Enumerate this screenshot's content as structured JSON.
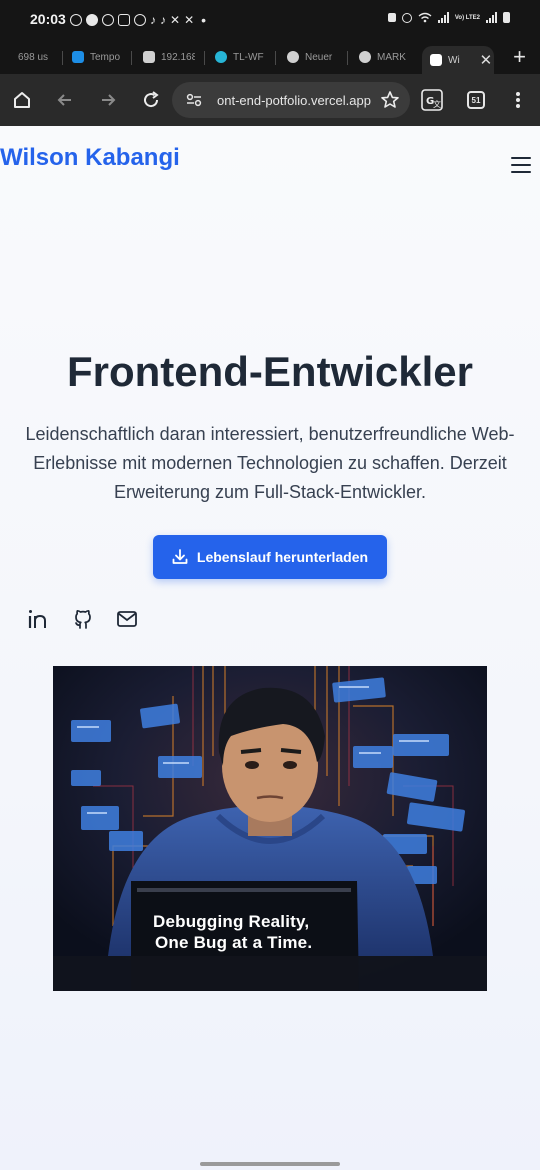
{
  "status_bar": {
    "time": "20:03",
    "network_label": "Vo) LTE2",
    "icons": [
      "whatsapp-icon",
      "chat-icon",
      "whatsapp-icon",
      "instagram-icon",
      "whatsapp-icon",
      "tiktok-icon",
      "tiktok-icon",
      "x-icon",
      "x-icon"
    ]
  },
  "browser": {
    "tabs": [
      {
        "label": "698 us",
        "favicon_color": "#666666"
      },
      {
        "label": "Tempo",
        "favicon_color": "#1d8ee6"
      },
      {
        "label": "192.168",
        "favicon_color": "#d0d0d0"
      },
      {
        "label": "TL-WF",
        "favicon_color": "#27b5d6"
      },
      {
        "label": "Neuer",
        "favicon_color": "#d0d0d0"
      },
      {
        "label": "MARK",
        "favicon_color": "#d0d0d0"
      },
      {
        "label": "Wi",
        "favicon_color": "#ffffff"
      }
    ],
    "url": "ont-end-potfolio.vercel.app",
    "tab_count": "51"
  },
  "page": {
    "brand": "Wilson Kabangi",
    "hero_title": "Frontend-Entwickler",
    "hero_text": "Leidenschaftlich daran interessiert, benutzerfreundliche Web-Erlebnisse mit modernen Technologien zu schaffen. Derzeit Erweiterung zum Full-Stack-Entwickler.",
    "cv_button": "Lebenslauf herunterladen",
    "socials": [
      "linkedin-icon",
      "github-icon",
      "mail-icon"
    ],
    "image_caption": [
      "Debugging Reality,",
      "One Bug at a Time."
    ]
  },
  "colors": {
    "accent": "#2563eb",
    "heading": "#1f2937",
    "body_text": "#374151"
  }
}
